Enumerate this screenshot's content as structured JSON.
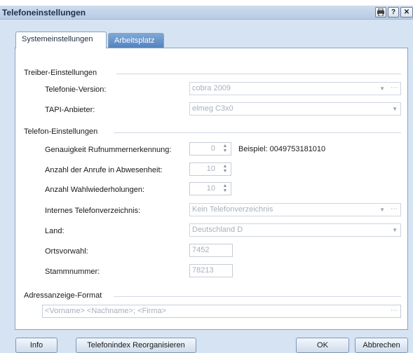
{
  "window": {
    "title": "Telefoneinstellungen",
    "titlebar_buttons": [
      "print-icon",
      "help-icon",
      "close-icon"
    ]
  },
  "tabs": [
    {
      "label": "Systemeinstellungen",
      "active": true
    },
    {
      "label": "Arbeitsplatz",
      "active": false
    }
  ],
  "driver_group": {
    "header": "Treiber-Einstellungen",
    "telephony_version": {
      "label": "Telefonie-Version:",
      "value": "cobra 2009"
    },
    "tapi_provider": {
      "label": "TAPI-Anbieter:",
      "value": "elmeg C3x0"
    }
  },
  "phone_group": {
    "header": "Telefon-Einstellungen",
    "accuracy": {
      "label": "Genauigkeit Rufnummernerkennung:",
      "value": "0",
      "example": "Beispiel:  0049753181010"
    },
    "calls_absence": {
      "label": "Anzahl der Anrufe in Abwesenheit:",
      "value": "10"
    },
    "redial_count": {
      "label": "Anzahl Wahlwiederholungen:",
      "value": "10"
    },
    "internal_directory": {
      "label": "Internes Telefonverzeichnis:",
      "value": "Kein Telefonverzeichnis"
    },
    "country": {
      "label": "Land:",
      "value": "Deutschland D"
    },
    "area_code": {
      "label": "Ortsvorwahl:",
      "value": "7452"
    },
    "base_number": {
      "label": "Stammnummer:",
      "value": "78213"
    }
  },
  "address_group": {
    "header": "Adressanzeige-Format",
    "format": "<Vorname> <Nachname>; <Firma>"
  },
  "buttons": {
    "info": "Info",
    "reorganize": "Telefonindex Reorganisieren",
    "ok": "OK",
    "cancel": "Abbrechen"
  },
  "colors": {
    "window_bg": "#d6e3f2",
    "tab_active_bg": "#ffffff",
    "tab_inactive_bg": "#4f7fbd",
    "disabled_text": "#a8b0bb"
  }
}
